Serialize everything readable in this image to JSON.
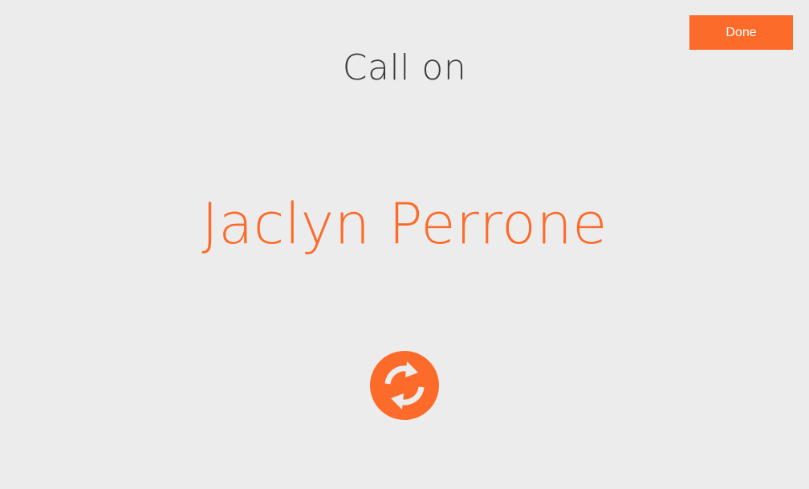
{
  "header": {
    "done_label": "Done"
  },
  "main": {
    "heading": "Call on",
    "student_name": "Jaclyn Perrone",
    "refresh_icon": "refresh-icon"
  },
  "colors": {
    "accent": "#fd6b2b",
    "background": "#ececec",
    "heading_text": "#3b3b3b",
    "button_text": "#ffffff"
  }
}
